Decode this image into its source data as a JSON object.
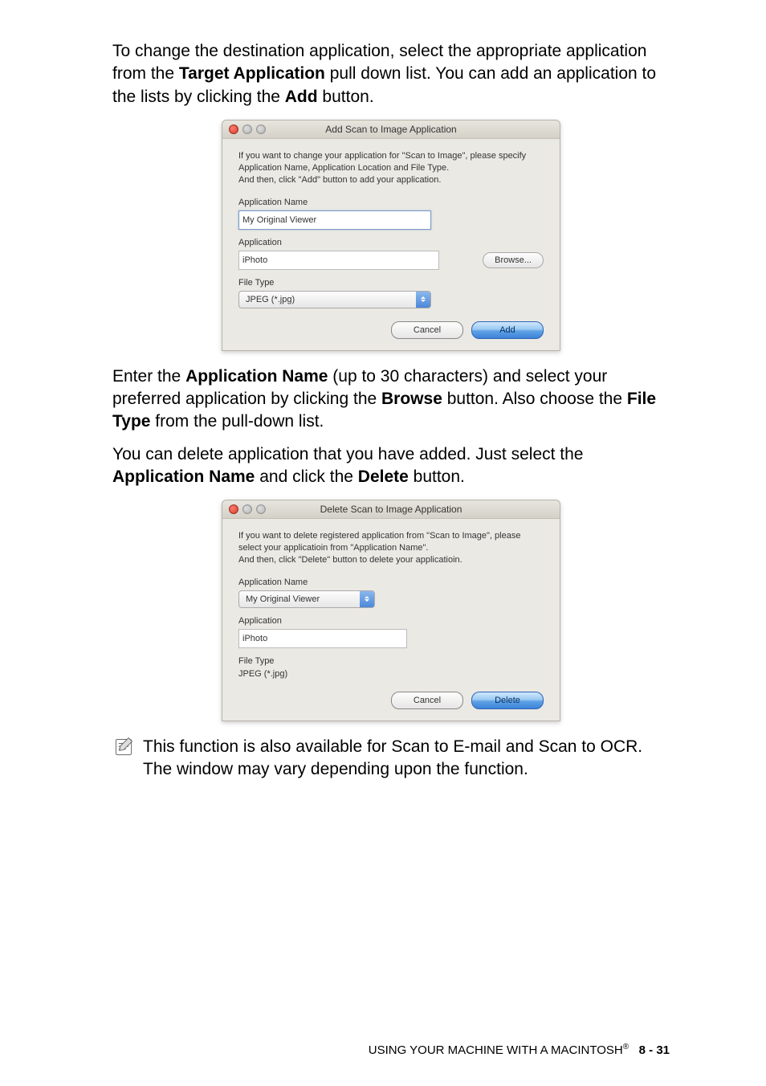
{
  "para1_before": "To change the destination application, select the appropriate application from the ",
  "para1_bold1": "Target Application",
  "para1_mid": " pull down list. You can add an application to the lists by clicking the ",
  "para1_bold2": "Add",
  "para1_end": " button.",
  "dialog_add": {
    "title": "Add Scan to Image Application",
    "instructions": "If you want to change your application for \"Scan to Image\", please specify Application Name, Application Location and File Type.\nAnd then, click \"Add\" button to add your application.",
    "app_name_label": "Application Name",
    "app_name_value": "My Original Viewer",
    "application_label": "Application",
    "application_value": "iPhoto",
    "browse_label": "Browse...",
    "file_type_label": "File Type",
    "file_type_value": "JPEG (*.jpg)",
    "cancel": "Cancel",
    "add": "Add"
  },
  "para2_before": "Enter the ",
  "para2_bold1": "Application Name",
  "para2_mid1": " (up to 30 characters) and select your preferred application by clicking the ",
  "para2_bold2": "Browse",
  "para2_mid2": " button. Also choose the ",
  "para2_bold3": "File Type",
  "para2_end": " from the pull-down list.",
  "para3_before": "You can delete application that you have added. Just select the ",
  "para3_bold1": "Application Name",
  "para3_mid": " and click the ",
  "para3_bold2": "Delete",
  "para3_end": " button.",
  "dialog_del": {
    "title": "Delete Scan to Image Application",
    "instructions": "If you want to delete registered application from \"Scan to Image\", please select your applicatioin from \"Application Name\".\nAnd then, click \"Delete\" button to delete your applicatioin.",
    "app_name_label": "Application Name",
    "app_name_value": "My Original Viewer",
    "application_label": "Application",
    "application_value": "iPhoto",
    "file_type_label": "File Type",
    "file_type_value": "JPEG (*.jpg)",
    "cancel": "Cancel",
    "delete": "Delete"
  },
  "note_text": "This function is also available for Scan to E-mail and Scan to OCR. The window may vary depending upon the function.",
  "footer_text": "USING YOUR MACHINE WITH A MACINTOSH",
  "footer_reg": "®",
  "footer_page": "8 - 31"
}
